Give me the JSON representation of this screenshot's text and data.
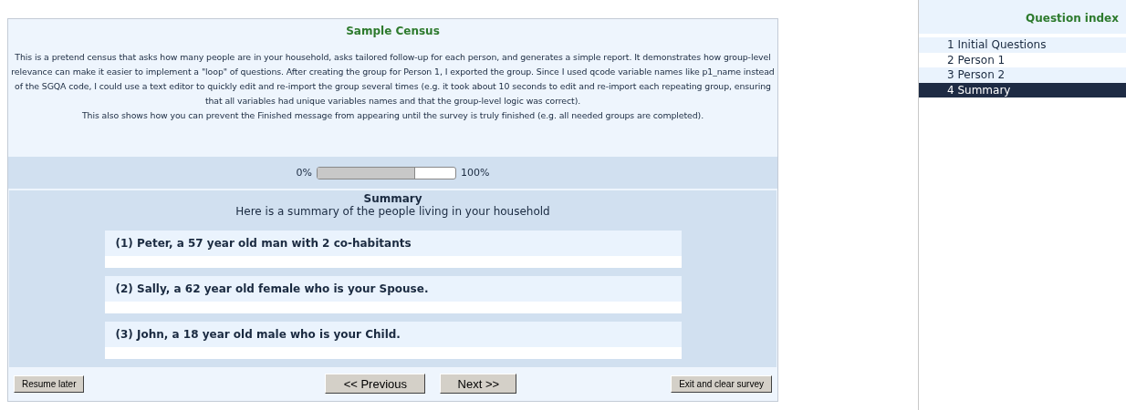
{
  "survey": {
    "title": "Sample Census",
    "description": [
      "This is a pretend census that asks how many people are in your household, asks tailored follow-up for each person, and generates a simple report. It demonstrates how group-level relevance can make it easier to implement a \"loop\" of questions. After creating the group for Person 1, I exported the group. Since I used qcode variable names like p1_name instead of the SGQA code, I could use a text editor to quickly edit and re-import the group several times (e.g. it took about 10 seconds to edit and re-import each repeating group, ensuring that all variables had unique variables names and that the group-level logic was correct).",
      "This also shows how you can prevent the Finished message from appearing until the survey is truly finished (e.g. all needed groups are completed)."
    ]
  },
  "progress": {
    "start_label": "0%",
    "end_label": "100%",
    "level": 0.71
  },
  "group": {
    "title": "Summary",
    "description": "Here is a summary of the people living in your household",
    "items": [
      {
        "text": "(1) Peter, a 57 year old man with 2 co-habitants"
      },
      {
        "text": "(2) Sally, a 62 year old female who is your Spouse."
      },
      {
        "text": "(3) John, a 18 year old male who is your Child."
      }
    ]
  },
  "buttons": {
    "resume": "Resume later",
    "previous": "<< Previous",
    "next": "Next >>",
    "exit": "Exit and clear survey"
  },
  "question_index": {
    "title": "Question index",
    "items": [
      {
        "label": "1 Initial Questions",
        "selected": false
      },
      {
        "label": "2 Person 1",
        "selected": false
      },
      {
        "label": "3 Person 2",
        "selected": false
      },
      {
        "label": "4 Summary",
        "selected": true
      }
    ]
  }
}
